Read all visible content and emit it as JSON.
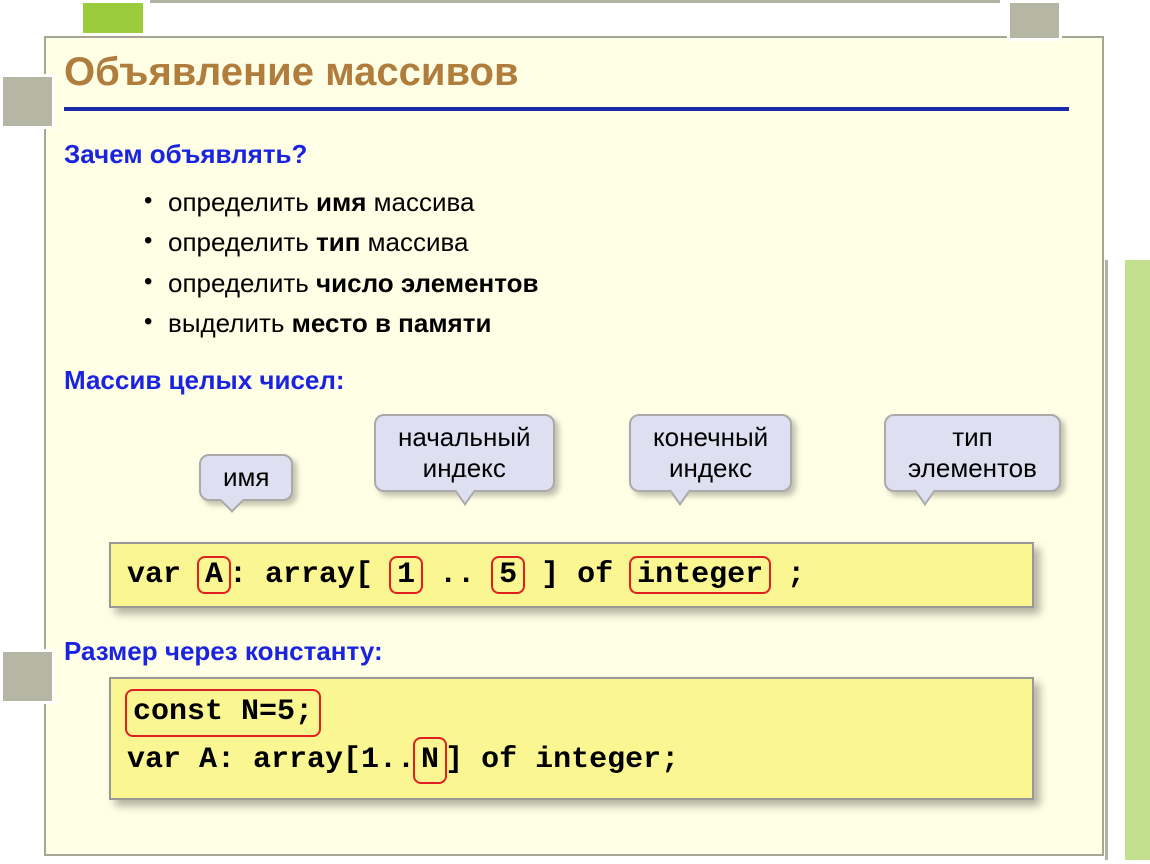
{
  "title": "Объявление массивов",
  "why": {
    "heading": "Зачем объявлять?",
    "items": [
      {
        "prefix": "определить ",
        "bold": "имя",
        "suffix": " массива"
      },
      {
        "prefix": "определить ",
        "bold": "тип",
        "suffix": " массива"
      },
      {
        "prefix": "определить ",
        "bold": "число элементов",
        "suffix": ""
      },
      {
        "prefix": "выделить ",
        "bold": "место в памяти",
        "suffix": ""
      }
    ]
  },
  "int_array_heading": "Массив целых чисел:",
  "callouts": {
    "name": "имя",
    "start_index": "начальный\nиндекс",
    "end_index": "конечный\nиндекс",
    "elem_type": "тип\nэлементов"
  },
  "code1": {
    "t1": "var ",
    "hl_name": "A",
    "t2": ": array[ ",
    "hl_start": "1",
    "t3": " .. ",
    "hl_end": "5",
    "t4": " ] of ",
    "hl_type": "integer",
    "t5": " ;"
  },
  "const_heading": "Размер через константу:",
  "code2": {
    "line1_hl": "const N=5;",
    "line2_a": "var A: array[1..",
    "line2_hl": "N",
    "line2_b": "] of integer;"
  }
}
